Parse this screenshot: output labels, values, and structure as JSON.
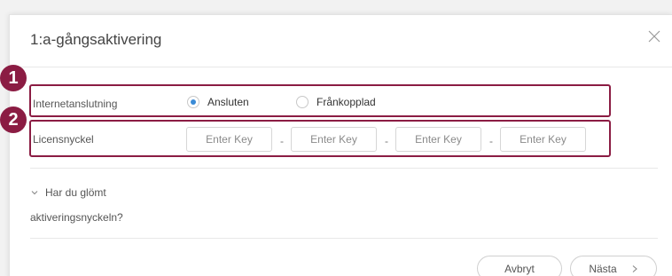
{
  "dialog": {
    "title": "1:a-gångsaktivering"
  },
  "badges": [
    "1",
    "2"
  ],
  "internet": {
    "label": "Internetanslutning",
    "options": [
      "Ansluten",
      "Frånkopplad"
    ],
    "selected": "Ansluten"
  },
  "license": {
    "label": "Licensnyckel",
    "placeholder": "Enter Key",
    "separator": "-"
  },
  "forgot": {
    "line1": "Har du glömt",
    "line2": "aktiveringsnyckeln?"
  },
  "buttons": {
    "cancel": "Avbryt",
    "next": "Nästa"
  },
  "colors": {
    "highlight": "#8b1c43",
    "radio_selected": "#3a8bd6"
  }
}
